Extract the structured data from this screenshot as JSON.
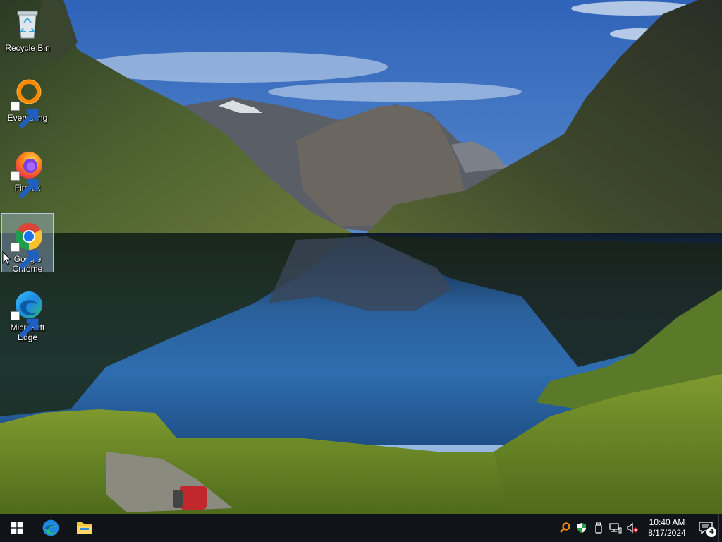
{
  "desktop": {
    "icons": [
      {
        "label": "Recycle Bin"
      },
      {
        "label": "Everything"
      },
      {
        "label": "Firefox"
      },
      {
        "label": "Google Chrome"
      },
      {
        "label": "Microsoft Edge"
      }
    ],
    "selected_icon": "Google Chrome"
  },
  "taskbar": {
    "pinned": [
      "windows-start-icon",
      "edge-icon",
      "file-explorer-icon"
    ],
    "tray_icons": [
      "everything-search-icon",
      "windows-security-icon",
      "usb-device-icon",
      "network-icon",
      "volume-muted-icon"
    ],
    "clock": {
      "time": "10:40 AM",
      "date": "8/17/2024"
    },
    "notifications": {
      "count": "4"
    }
  },
  "colors": {
    "taskbar": "#101418",
    "accent": "#76b9ed",
    "selection": "#aac8eb"
  }
}
